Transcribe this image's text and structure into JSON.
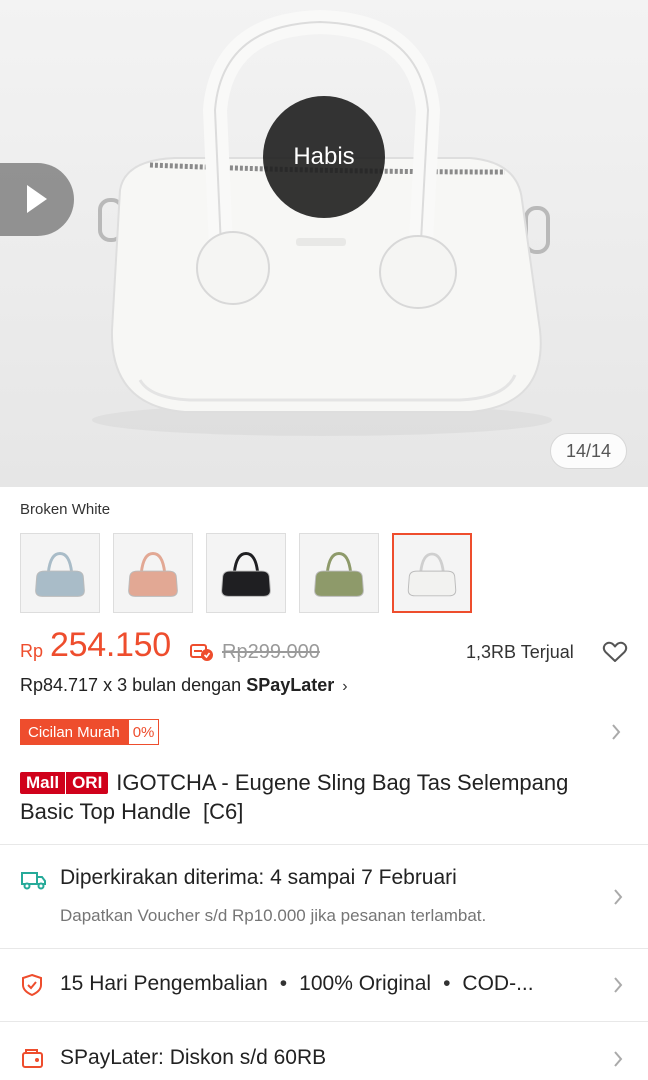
{
  "hero": {
    "badge_text": "Habis",
    "image_counter": "14/14",
    "play_icon": "play-icon"
  },
  "variants": {
    "selected_label": "Broken White",
    "options": [
      {
        "color": "#a9bcc8"
      },
      {
        "color": "#e2a894"
      },
      {
        "color": "#1f1f22"
      },
      {
        "color": "#8e9a6a"
      },
      {
        "color": "#f2f2f0"
      }
    ],
    "selected_index": 4
  },
  "price": {
    "currency": "Rp",
    "current": "254.150",
    "original": "Rp299.000",
    "sold": "1,3RB Terjual",
    "accent_color": "#ee4d2d"
  },
  "spaylater": {
    "prefix": "Rp84.717 x 3 bulan dengan ",
    "brand": "SPayLater",
    "chevron": "›"
  },
  "cicilan": {
    "label": "Cicilan Murah",
    "percent": "0%"
  },
  "product": {
    "mall_label": "Mall",
    "ori_label": "ORI",
    "title": "IGOTCHA - Eugene Sling Bag Tas Selempang Basic Top Handle  [C6]"
  },
  "shipping": {
    "title": "Diperkirakan diterima: 4 sampai 7 Februari",
    "subtitle": "Dapatkan Voucher s/d Rp10.000 jika pesanan terlambat."
  },
  "guarantee": {
    "items": [
      "15 Hari Pengembalian",
      "100% Original",
      "COD-..."
    ]
  },
  "promo": {
    "text": "SPayLater: Diskon s/d 60RB"
  }
}
